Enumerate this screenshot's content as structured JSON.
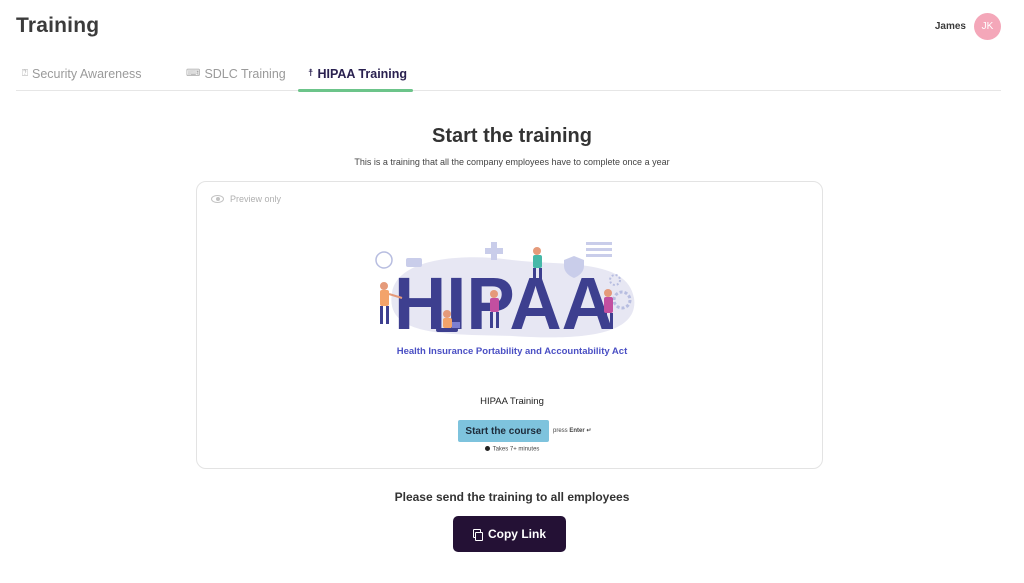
{
  "header": {
    "title": "Training",
    "user": {
      "name": "James",
      "initials": "JK",
      "avatar_color": "#f4a7b9"
    }
  },
  "tabs": [
    {
      "label": "Security Awareness",
      "icon": "lock-person-icon",
      "active": false
    },
    {
      "label": "SDLC Training",
      "icon": "code-icon",
      "active": false
    },
    {
      "label": "HIPAA Training",
      "icon": "medical-icon",
      "active": true
    }
  ],
  "main": {
    "heading": "Start the training",
    "subheading": "This is a training that all the company employees have to complete once a year",
    "preview": {
      "label": "Preview only",
      "hero_word": "HIPAA",
      "hero_caption": "Health Insurance Portability and Accountability Act",
      "course_title": "HIPAA Training",
      "start_button": "Start the course",
      "press_hint_prefix": "press",
      "press_hint_key": "Enter ↵",
      "duration": "Takes 7+ minutes"
    },
    "send_text": "Please send the training to all employees",
    "copy_button": "Copy Link"
  },
  "colors": {
    "active_tab_underline": "#6cc48a",
    "active_tab_text": "#2a2150",
    "start_button_bg": "#7ec3dd",
    "copy_button_bg": "#241135",
    "hero_letters": "#3d3f8f",
    "hero_caption": "#4a4fc4"
  }
}
